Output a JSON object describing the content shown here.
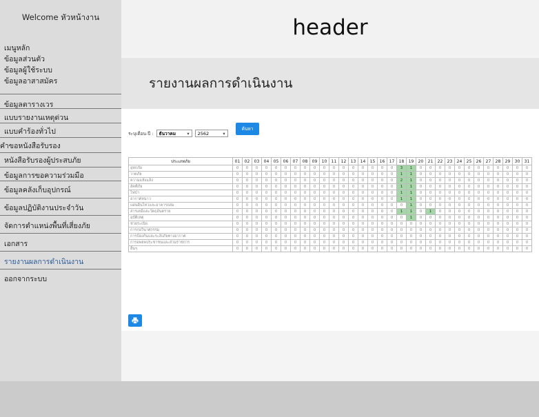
{
  "sidebar": {
    "welcome": "Welcome หัวหน้างาน",
    "top_items": [
      "เมนูหลัก",
      "ข้อมูลส่วนตัว",
      "ข้อมูลผู้ใช้ระบบ",
      "ข้อมูลอาสาสมัคร"
    ],
    "items": [
      {
        "label": "ข้อมูลตารางเวร"
      },
      {
        "label": "แบบรายงานเหตุด่วน"
      },
      {
        "label": "แบบคำร้องทั่วไป"
      },
      {
        "label": "คำขอหนังสือรับรอง"
      },
      {
        "label": "หนังสือรับรองผู้ประสบภัย"
      },
      {
        "label": "ข้อมูลการขอความร่วมมือ"
      },
      {
        "label": "ข้อมูลคลังเก็บอุปกรณ์"
      },
      {
        "label": "ข้อมูลปฏิบัติงานประจำวัน"
      },
      {
        "label": "จัดการตำแหน่งพื้นที่เสี่ยงภัย"
      },
      {
        "label": "เอกสาร"
      },
      {
        "label": "รายงานผลการดำเนินงาน"
      },
      {
        "label": "ออกจากระบบ"
      }
    ],
    "active_color": "#2b5b9b"
  },
  "header": {
    "title": "header"
  },
  "page": {
    "title": "รายงานผลการดำเนินงาน"
  },
  "filter": {
    "label": "ระบุเดือน-ปี :",
    "month": "ธันวาคม",
    "year": "2562",
    "search_label": "ค้นหา"
  },
  "table": {
    "category_header": "ประเภทภัย",
    "days": [
      "01",
      "02",
      "03",
      "04",
      "05",
      "06",
      "07",
      "08",
      "09",
      "10",
      "11",
      "12",
      "13",
      "14",
      "15",
      "16",
      "17",
      "18",
      "19",
      "20",
      "21",
      "22",
      "23",
      "24",
      "25",
      "26",
      "27",
      "28",
      "29",
      "30",
      "31"
    ],
    "rows": [
      {
        "name": "อุทกภัย",
        "values": [
          0,
          0,
          0,
          0,
          0,
          0,
          0,
          0,
          0,
          0,
          0,
          0,
          0,
          0,
          0,
          0,
          0,
          3,
          1,
          0,
          0,
          0,
          0,
          0,
          0,
          0,
          0,
          0,
          0,
          0,
          0
        ]
      },
      {
        "name": "วาตภัย",
        "values": [
          0,
          0,
          0,
          0,
          0,
          0,
          0,
          0,
          0,
          0,
          0,
          0,
          0,
          0,
          0,
          0,
          0,
          1,
          1,
          0,
          0,
          0,
          0,
          0,
          0,
          0,
          0,
          0,
          0,
          0,
          0
        ]
      },
      {
        "name": "ความแห้งแล้ง",
        "values": [
          0,
          0,
          0,
          0,
          0,
          0,
          0,
          0,
          0,
          0,
          0,
          0,
          0,
          0,
          0,
          0,
          0,
          2,
          1,
          0,
          0,
          0,
          0,
          0,
          0,
          0,
          0,
          0,
          0,
          0,
          0
        ]
      },
      {
        "name": "อัคคีภัย",
        "values": [
          0,
          0,
          0,
          0,
          0,
          0,
          0,
          0,
          0,
          0,
          0,
          0,
          0,
          0,
          0,
          0,
          0,
          1,
          1,
          0,
          0,
          0,
          0,
          0,
          0,
          0,
          0,
          0,
          0,
          0,
          0
        ]
      },
      {
        "name": "ไฟป่า",
        "values": [
          0,
          0,
          0,
          0,
          0,
          0,
          0,
          0,
          0,
          0,
          0,
          0,
          0,
          0,
          0,
          0,
          0,
          1,
          1,
          0,
          0,
          0,
          0,
          0,
          0,
          0,
          0,
          0,
          0,
          0,
          0
        ]
      },
      {
        "name": "อากาศหนาว",
        "values": [
          0,
          0,
          0,
          0,
          0,
          0,
          0,
          0,
          0,
          0,
          0,
          0,
          0,
          0,
          0,
          0,
          0,
          1,
          1,
          0,
          0,
          0,
          0,
          0,
          0,
          0,
          0,
          0,
          0,
          0,
          0
        ]
      },
      {
        "name": "แผ่นดินไหวและอาคารถล่ม",
        "values": [
          0,
          0,
          0,
          0,
          0,
          0,
          0,
          0,
          0,
          0,
          0,
          0,
          0,
          0,
          0,
          0,
          0,
          0,
          1,
          0,
          0,
          0,
          0,
          0,
          0,
          0,
          0,
          0,
          0,
          0,
          0
        ]
      },
      {
        "name": "สารเคมีและวัตถุอันตราย",
        "values": [
          0,
          0,
          0,
          0,
          0,
          0,
          0,
          0,
          0,
          0,
          0,
          0,
          0,
          0,
          0,
          0,
          0,
          1,
          1,
          0,
          1,
          0,
          0,
          0,
          0,
          0,
          0,
          0,
          0,
          0,
          0
        ]
      },
      {
        "name": "อุบัติเหตุ",
        "values": [
          0,
          0,
          0,
          0,
          0,
          0,
          0,
          0,
          0,
          0,
          0,
          0,
          0,
          0,
          0,
          0,
          0,
          0,
          1,
          0,
          0,
          0,
          0,
          0,
          0,
          0,
          0,
          0,
          0,
          0,
          0
        ]
      },
      {
        "name": "ช่วยระเบิด",
        "values": [
          0,
          0,
          0,
          0,
          0,
          0,
          0,
          0,
          0,
          0,
          0,
          0,
          0,
          0,
          0,
          0,
          0,
          0,
          0,
          0,
          0,
          0,
          0,
          0,
          0,
          0,
          0,
          0,
          0,
          0,
          0
        ]
      },
      {
        "name": "การก่อวินาศกรรม",
        "values": [
          0,
          0,
          0,
          0,
          0,
          0,
          0,
          0,
          0,
          0,
          0,
          0,
          0,
          0,
          0,
          0,
          0,
          0,
          0,
          0,
          0,
          0,
          0,
          0,
          0,
          0,
          0,
          0,
          0,
          0,
          0
        ]
      },
      {
        "name": "การป้องกันและระงับภัยทางอากาศ",
        "values": [
          0,
          0,
          0,
          0,
          0,
          0,
          0,
          0,
          0,
          0,
          0,
          0,
          0,
          0,
          0,
          0,
          0,
          0,
          0,
          0,
          0,
          0,
          0,
          0,
          0,
          0,
          0,
          0,
          0,
          0,
          0
        ]
      },
      {
        "name": "การอพยพประชาชนและส่วนราชการ",
        "values": [
          0,
          0,
          0,
          0,
          0,
          0,
          0,
          0,
          0,
          0,
          0,
          0,
          0,
          0,
          0,
          0,
          0,
          0,
          0,
          0,
          0,
          0,
          0,
          0,
          0,
          0,
          0,
          0,
          0,
          0,
          0
        ]
      },
      {
        "name": "อื่นๆ",
        "values": [
          0,
          0,
          0,
          0,
          0,
          0,
          0,
          0,
          0,
          0,
          0,
          0,
          0,
          0,
          0,
          0,
          0,
          0,
          0,
          0,
          0,
          0,
          0,
          0,
          0,
          0,
          0,
          0,
          0,
          0,
          0
        ]
      }
    ],
    "highlight_color": "#a5d6a7"
  },
  "print": {
    "icon": "print-icon"
  }
}
